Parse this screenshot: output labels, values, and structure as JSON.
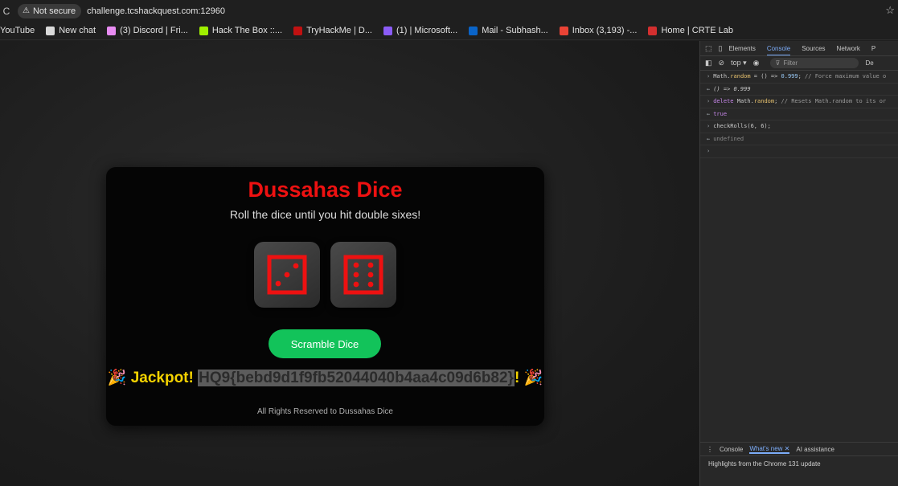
{
  "browser": {
    "reload_glyph": "C",
    "security_label": "Not secure",
    "url": "challenge.tcshackquest.com:12960",
    "bookmarks": [
      {
        "label": "YouTube",
        "color": ""
      },
      {
        "label": "New chat",
        "color": "#d9d9d9"
      },
      {
        "label": "(3) Discord | Fri...",
        "color": "#e88cf2"
      },
      {
        "label": "Hack The Box ::...",
        "color": "#9fef00"
      },
      {
        "label": "TryHackMe | D...",
        "color": "#c11111"
      },
      {
        "label": "(1) | Microsoft...",
        "color": "#8b5cf6"
      },
      {
        "label": "Mail - Subhash...",
        "color": "#0a64c8"
      },
      {
        "label": "Inbox (3,193) -...",
        "color": "#ea4335"
      },
      {
        "label": "Home | CRTE Lab",
        "color": "#d32f2f"
      }
    ]
  },
  "game": {
    "title": "Dussahas Dice",
    "subtitle": "Roll the dice until you hit double sixes!",
    "die1_value": 3,
    "die2_value": 6,
    "die_color": "#ee1111",
    "button_label": "Scramble Dice",
    "result_prefix": "🎉 Jackpot! ",
    "flag": "HQ9{bebd9d1f9fb52044040b4aa4c09d6b82}",
    "result_suffix": "! 🎉",
    "footer": "All Rights Reserved to Dussahas Dice"
  },
  "devtools": {
    "tabs": [
      "Elements",
      "Console",
      "Sources",
      "Network",
      "P"
    ],
    "active_tab": "Console",
    "context": "top ▾",
    "filter_placeholder": "Filter",
    "level": "De",
    "console_lines": [
      {
        "kind": "input",
        "parts": [
          [
            "fn",
            "Math."
          ],
          [
            "prop",
            "random"
          ],
          [
            "fn",
            " = () => "
          ],
          [
            "num",
            "0.999"
          ],
          [
            "fn",
            "; "
          ],
          [
            "cm",
            "// Force maximum value o"
          ]
        ]
      },
      {
        "kind": "output",
        "parts": [
          [
            "out-italic",
            "() => 0.999"
          ]
        ]
      },
      {
        "kind": "input",
        "parts": [
          [
            "kw",
            "delete "
          ],
          [
            "fn",
            "Math."
          ],
          [
            "prop",
            "random"
          ],
          [
            "fn",
            "; "
          ],
          [
            "cm",
            "// Resets Math.random to its or"
          ]
        ]
      },
      {
        "kind": "output",
        "parts": [
          [
            "kw",
            "true"
          ]
        ]
      },
      {
        "kind": "input",
        "parts": [
          [
            "fn",
            "checkRolls(6, 6);"
          ]
        ]
      },
      {
        "kind": "output",
        "parts": [
          [
            "undef",
            "undefined"
          ]
        ]
      },
      {
        "kind": "caret",
        "parts": []
      }
    ],
    "drawer_tabs": [
      "Console",
      "What's new",
      "AI assistance"
    ],
    "drawer_active": "What's new",
    "drawer_text": "Highlights from the Chrome 131 update"
  }
}
